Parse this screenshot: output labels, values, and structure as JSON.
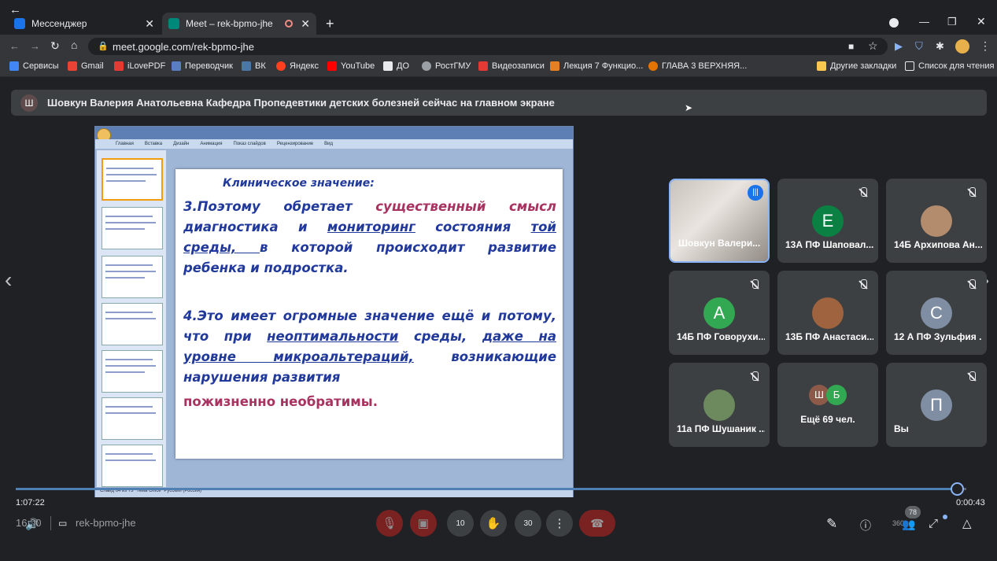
{
  "browser": {
    "tabs": [
      {
        "label": "Мессенджер",
        "active": false
      },
      {
        "label": "Meet – rek-bpmo-jhe",
        "active": true
      }
    ],
    "url": "meet.google.com/rek-bpmo-jhe",
    "bookmarks": [
      "Сервисы",
      "Gmail",
      "iLovePDF",
      "Переводчик",
      "ВК",
      "Яндекс",
      "YouTube",
      "ДО",
      "РостГМУ",
      "Видеозаписи",
      "Лекция 7 Функцио...",
      "ГЛАВА 3 ВЕРХНЯЯ..."
    ],
    "bookmarks_right": [
      "Другие закладки",
      "Список для чтения"
    ]
  },
  "meet": {
    "banner_avatar": "Ш",
    "banner_text": "Шовкун Валерия Анатольевна Кафедра Пропедевтики детских болезней сейчас на главном экране",
    "slide": {
      "heading": "Клиническое значение:",
      "line1_a": "3.Поэтому обретает ",
      "line1_b": "существенный смысл",
      "line2_a": "диагностика и ",
      "line2_b": "мониторинг",
      "line2_c": " состояния ",
      "line2_d": "той",
      "line3_a": "среды,   ",
      "line3_b": " в которой происходит развитие",
      "line4": "ребенка и подростка.",
      "line5": "4.Это имеет огромные значение ещё и потому,",
      "line6_a": "что при ",
      "line6_b": "неоптимальности",
      "line6_c": " среды, ",
      "line6_d": "даже на",
      "line7_a": "уровне микроальтераций,",
      "line7_b": " возникающие",
      "line8": "нарушения развития",
      "line9": "пожизненно необратимы."
    },
    "ppt_tabs": [
      "Главная",
      "Вставка",
      "Дизайн",
      "Анимация",
      "Показ слайдов",
      "Рецензирование",
      "Вид"
    ],
    "ppt_status": "Слайд 64 из 73    \"Тема Office\"    Русский (Россия)",
    "participants": [
      {
        "name": "Шовкун Валери...",
        "initial": "",
        "color": "#8a8f96"
      },
      {
        "name": "13А ПФ Шаповал...",
        "initial": "Е",
        "color": "#0b8043"
      },
      {
        "name": "14Б Архипова Ан...",
        "initial": "",
        "color": "#b38b6d"
      },
      {
        "name": "14Б ПФ Говорухи...",
        "initial": "А",
        "color": "#33a852"
      },
      {
        "name": "13Б ПФ Анастаси...",
        "initial": "",
        "color": "#a0633f"
      },
      {
        "name": "12 А ПФ Зульфия ...",
        "initial": "С",
        "color": "#7f8ea3"
      },
      {
        "name": "11а ПФ Шушаник ...",
        "initial": "",
        "color": "#6d8a5f"
      },
      {
        "name": "Ещё 69 чел.",
        "initial": "",
        "color": ""
      },
      {
        "name": "Вы",
        "initial": "П",
        "color": "#7f8ea3"
      }
    ],
    "more_avatars": [
      "Ш",
      "Б"
    ],
    "time_elapsed": "1:07:22",
    "time_remaining": "0:00:43",
    "progress": 0.99,
    "clock": "16:00",
    "meeting_code": "rek-bpmo-jhe",
    "people_count": "78",
    "skip_back": "10",
    "skip_fwd": "30",
    "speed": "360"
  }
}
